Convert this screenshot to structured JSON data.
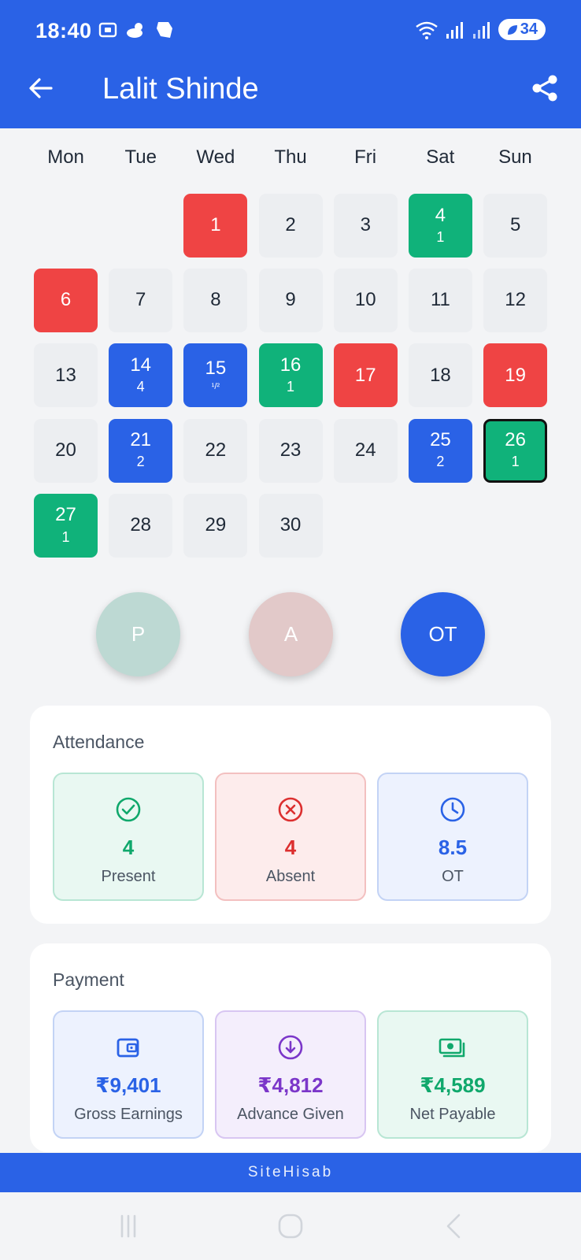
{
  "status_bar": {
    "time": "18:40",
    "battery": "34"
  },
  "header": {
    "title": "Lalit Shinde",
    "accent_color": "#2a62e6"
  },
  "calendar": {
    "weekdays": [
      "Mon",
      "Tue",
      "Wed",
      "Thu",
      "Fri",
      "Sat",
      "Sun"
    ],
    "days": [
      {
        "day": "",
        "status": "empty",
        "sub": ""
      },
      {
        "day": "",
        "status": "empty",
        "sub": ""
      },
      {
        "day": "1",
        "status": "absent",
        "sub": ""
      },
      {
        "day": "2",
        "status": "none",
        "sub": ""
      },
      {
        "day": "3",
        "status": "none",
        "sub": ""
      },
      {
        "day": "4",
        "status": "present",
        "sub": "1"
      },
      {
        "day": "5",
        "status": "none",
        "sub": ""
      },
      {
        "day": "6",
        "status": "absent",
        "sub": ""
      },
      {
        "day": "7",
        "status": "none",
        "sub": ""
      },
      {
        "day": "8",
        "status": "none",
        "sub": ""
      },
      {
        "day": "9",
        "status": "none",
        "sub": ""
      },
      {
        "day": "10",
        "status": "none",
        "sub": ""
      },
      {
        "day": "11",
        "status": "none",
        "sub": ""
      },
      {
        "day": "12",
        "status": "none",
        "sub": ""
      },
      {
        "day": "13",
        "status": "none",
        "sub": ""
      },
      {
        "day": "14",
        "status": "ot",
        "sub": "4"
      },
      {
        "day": "15",
        "status": "ot",
        "sub": "¹/²",
        "small": true
      },
      {
        "day": "16",
        "status": "present",
        "sub": "1"
      },
      {
        "day": "17",
        "status": "absent",
        "sub": ""
      },
      {
        "day": "18",
        "status": "none",
        "sub": ""
      },
      {
        "day": "19",
        "status": "absent",
        "sub": ""
      },
      {
        "day": "20",
        "status": "none",
        "sub": ""
      },
      {
        "day": "21",
        "status": "ot",
        "sub": "2"
      },
      {
        "day": "22",
        "status": "none",
        "sub": ""
      },
      {
        "day": "23",
        "status": "none",
        "sub": ""
      },
      {
        "day": "24",
        "status": "none",
        "sub": ""
      },
      {
        "day": "25",
        "status": "ot",
        "sub": "2"
      },
      {
        "day": "26",
        "status": "present",
        "sub": "1",
        "today": true
      },
      {
        "day": "27",
        "status": "present",
        "sub": "1"
      },
      {
        "day": "28",
        "status": "none",
        "sub": ""
      },
      {
        "day": "29",
        "status": "none",
        "sub": ""
      },
      {
        "day": "30",
        "status": "none",
        "sub": ""
      }
    ]
  },
  "mode_buttons": {
    "present": "P",
    "absent": "A",
    "overtime": "OT"
  },
  "attendance": {
    "title": "Attendance",
    "present_value": "4",
    "present_label": "Present",
    "absent_value": "4",
    "absent_label": "Absent",
    "ot_value": "8.5",
    "ot_label": "OT"
  },
  "payment": {
    "title": "Payment",
    "gross_value": "₹9,401",
    "gross_label": "Gross Earnings",
    "advance_value": "₹4,812",
    "advance_label": "Advance Given",
    "net_value": "₹4,589",
    "net_label": "Net Payable"
  },
  "footer": {
    "brand": "SiteHisab"
  },
  "icons": {
    "back": "arrow-left-icon",
    "share": "share-icon",
    "present": "check-circle-icon",
    "absent": "x-circle-icon",
    "ot": "clock-icon",
    "gross": "wallet-icon",
    "advance": "download-circle-icon",
    "net": "cash-icon"
  }
}
